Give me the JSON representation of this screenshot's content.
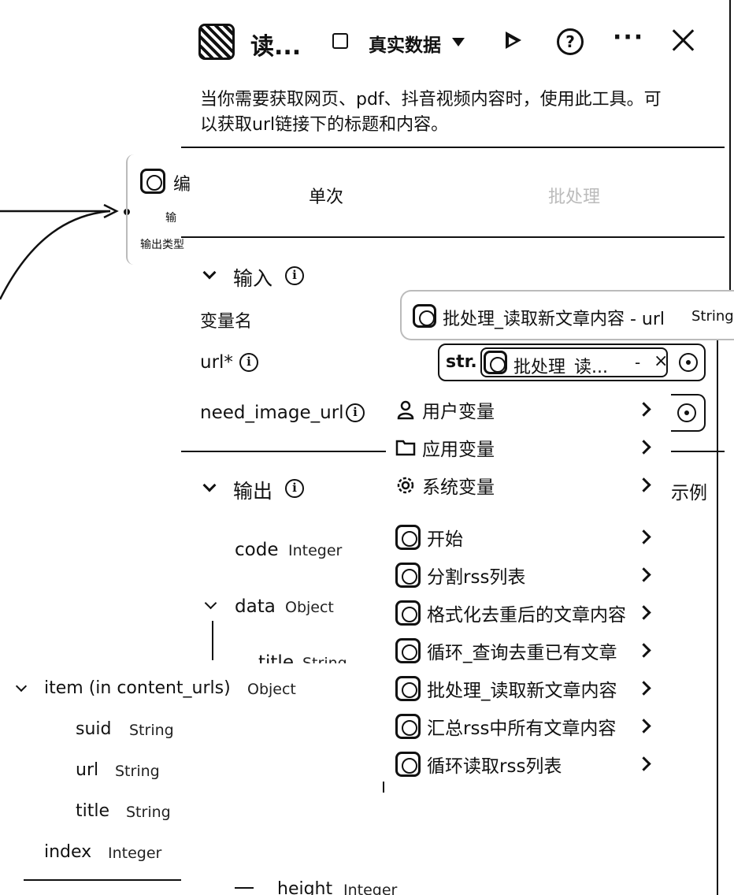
{
  "header": {
    "title": "读...",
    "data_label": "真实数据",
    "icons": [
      "app-icon",
      "data-icon",
      "dropdown-caret-icon",
      "run-icon",
      "help-icon",
      "more-icon",
      "close-icon"
    ]
  },
  "description": [
    "当你需要获取网页、pdf、抖音视频内容时，使用此工具。可",
    "以获取url链接下的标题和内容。"
  ],
  "tabs": [
    {
      "label": "单次",
      "active": true
    },
    {
      "label": "批处理",
      "active": false
    }
  ],
  "background_node": {
    "title": "编",
    "line1": "输",
    "line2": "输出类型"
  },
  "input_section": {
    "title": "输入",
    "var_name_label": "变量名",
    "fields": [
      {
        "name": "url*"
      },
      {
        "name": "need_image_url"
      }
    ],
    "selected_var": {
      "label": "批处理_读取新文章内容 - url",
      "type": "String"
    },
    "url_field": {
      "prefix": "str.",
      "value": "批处理_读...",
      "dash": "-",
      "clear": "×"
    }
  },
  "output_section": {
    "title": "输出",
    "example_label": "示例",
    "fields": [
      {
        "name": "code",
        "type": "Integer"
      },
      {
        "name": "data",
        "type": "Object"
      },
      {
        "name": "title",
        "type": "String"
      },
      {
        "name": "height",
        "type": "Integer"
      }
    ]
  },
  "variable_menu": {
    "categories": [
      {
        "label": "用户变量",
        "icon": "user-icon"
      },
      {
        "label": "应用变量",
        "icon": "folder-icon"
      },
      {
        "label": "系统变量",
        "icon": "gear-icon"
      }
    ],
    "nodes": [
      {
        "label": "开始",
        "icon": "start-node-icon"
      },
      {
        "label": "分割rss列表",
        "icon": "str-node-icon"
      },
      {
        "label": "格式化去重后的文章内容",
        "icon": "code-node-icon"
      },
      {
        "label": "循环_查询去重已有文章",
        "icon": "loop-node-icon"
      },
      {
        "label": "批处理_读取新文章内容",
        "icon": "batch-node-icon"
      },
      {
        "label": "汇总rss中所有文章内容",
        "icon": "code-node-icon"
      },
      {
        "label": "循环读取rss列表",
        "icon": "loop-node-icon"
      }
    ]
  },
  "left_panel": {
    "item": {
      "name": "item (in content_urls)",
      "type": "Object"
    },
    "children": [
      {
        "name": "suid",
        "type": "String"
      },
      {
        "name": "url",
        "type": "String"
      },
      {
        "name": "title",
        "type": "String"
      }
    ],
    "index": {
      "name": "index",
      "type": "Integer"
    }
  }
}
